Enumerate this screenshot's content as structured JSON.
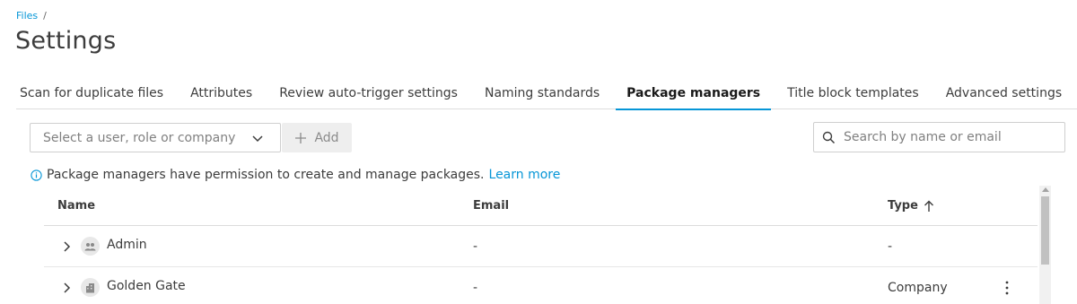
{
  "breadcrumb": {
    "items": [
      "Files"
    ],
    "separator": "/"
  },
  "page_title": "Settings",
  "tabs": [
    {
      "label": "Scan for duplicate files",
      "active": false
    },
    {
      "label": "Attributes",
      "active": false
    },
    {
      "label": "Review auto-trigger settings",
      "active": false
    },
    {
      "label": "Naming standards",
      "active": false
    },
    {
      "label": "Package managers",
      "active": true
    },
    {
      "label": "Title block templates",
      "active": false
    },
    {
      "label": "Advanced settings",
      "active": false
    }
  ],
  "picker": {
    "placeholder": "Select a user, role or company",
    "icon": "chevron-down-icon"
  },
  "add_button": {
    "label": "Add",
    "icon": "plus-icon"
  },
  "search": {
    "placeholder": "Search by name or email",
    "icon": "search-icon"
  },
  "info": {
    "icon": "info-icon",
    "text": "Package managers have permission to create and manage packages.",
    "link": "Learn more"
  },
  "table": {
    "columns": {
      "name": "Name",
      "email": "Email",
      "type": "Type",
      "sort_icon": "arrow-up-icon"
    },
    "rows": [
      {
        "name": "Admin",
        "email": "-",
        "type": "-",
        "icon": "role-group-icon"
      },
      {
        "name": "Golden Gate",
        "email": "-",
        "type": "Company",
        "icon": "company-building-icon"
      }
    ]
  },
  "colors": {
    "accent": "#0696d7",
    "text": "#3c3c3c",
    "border": "#dcdcdc"
  }
}
